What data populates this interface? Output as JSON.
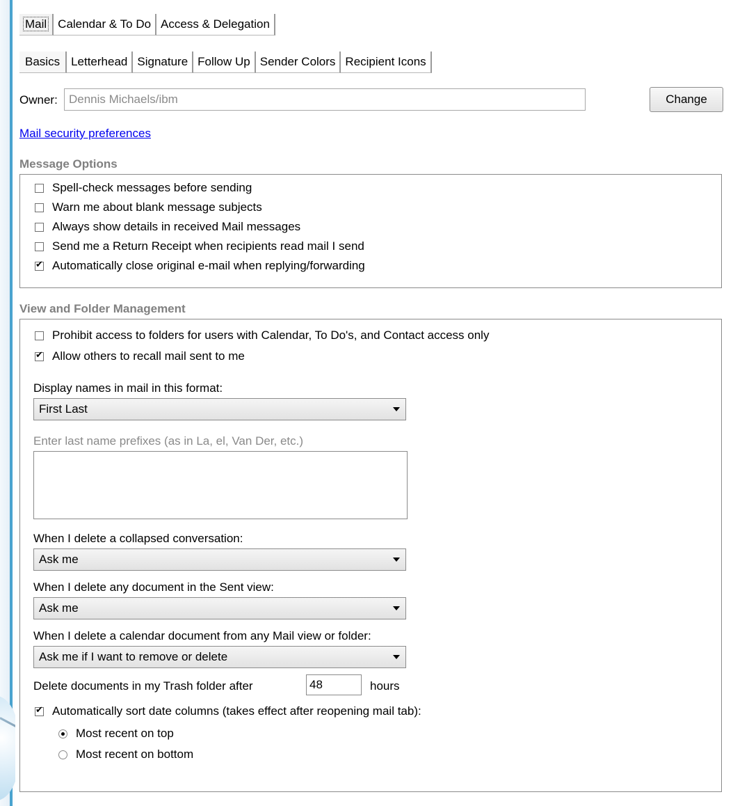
{
  "tabs_top": [
    "Mail",
    "Calendar & To Do",
    "Access & Delegation"
  ],
  "tabs_sub": [
    "Basics",
    "Letterhead",
    "Signature",
    "Follow Up",
    "Sender Colors",
    "Recipient Icons"
  ],
  "owner": {
    "label": "Owner:",
    "value": "Dennis Michaels/ibm",
    "change_label": "Change"
  },
  "security_link": "Mail security preferences",
  "message_options": {
    "title": "Message Options",
    "items": [
      {
        "label": "Spell-check messages before sending",
        "checked": false
      },
      {
        "label": "Warn me about blank message subjects",
        "checked": false
      },
      {
        "label": "Always show details in received Mail messages",
        "checked": false
      },
      {
        "label": "Send me a Return Receipt when recipients read mail I send",
        "checked": false
      },
      {
        "label": "Automatically close original e-mail when replying/forwarding",
        "checked": true
      }
    ]
  },
  "view_folder": {
    "title": "View and Folder Management",
    "prohibit_label": "Prohibit access to folders for users with Calendar, To Do's, and Contact access only",
    "prohibit_checked": false,
    "recall_label": "Allow others to recall mail sent to me",
    "recall_checked": true,
    "display_names_label": "Display names in mail in this format:",
    "display_names_value": "First Last",
    "prefixes_label": "Enter last name prefixes (as in La, el, Van Der, etc.)",
    "collapsed_label": "When I delete a collapsed conversation:",
    "collapsed_value": "Ask me",
    "sent_label": "When I delete any document in the Sent view:",
    "sent_value": "Ask me",
    "calendar_label": "When I delete a calendar document from any Mail view or folder:",
    "calendar_value": "Ask me if I want to remove or delete",
    "trash_prefix": "Delete documents in my Trash folder after",
    "trash_value": "48",
    "trash_suffix": "hours",
    "sort_label": "Automatically sort date columns (takes effect after reopening mail tab):",
    "sort_checked": true,
    "sort_options": [
      {
        "label": "Most recent on top",
        "selected": true
      },
      {
        "label": "Most recent on bottom",
        "selected": false
      }
    ]
  }
}
